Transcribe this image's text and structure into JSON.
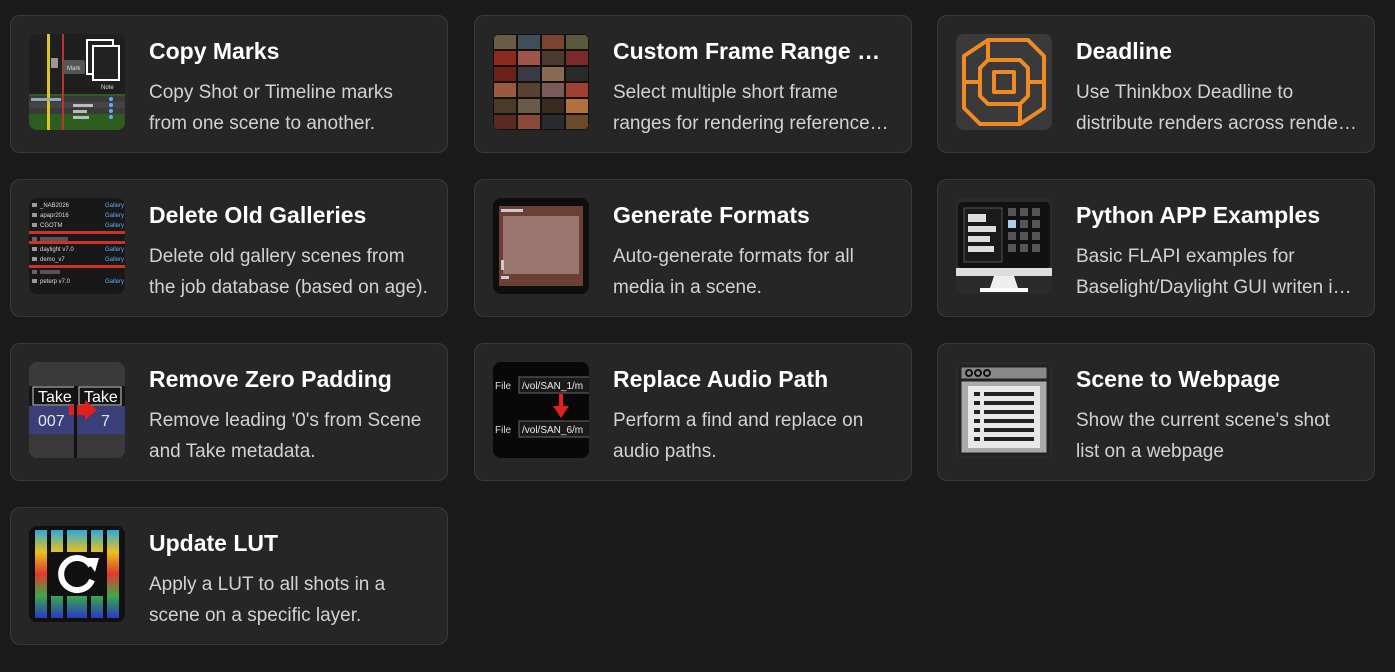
{
  "cards": [
    {
      "title": "Copy Marks",
      "desc": "Copy Shot or Timeline marks from one scene to another.",
      "icon": "copy-marks-icon"
    },
    {
      "title": "Custom Frame Range Selection",
      "desc": "Select multiple short frame ranges for rendering reference clips.",
      "icon": "frame-grid-icon"
    },
    {
      "title": "Deadline",
      "desc": "Use Thinkbox Deadline to distribute renders across render nodes.",
      "icon": "deadline-logo-icon"
    },
    {
      "title": "Delete Old Galleries",
      "desc": "Delete old gallery scenes from the job database (based on age).",
      "icon": "gallery-list-icon",
      "thumb_text": {
        "r1": "_NAB2026",
        "r2": "apapr2016",
        "r3": "CGOTM",
        "r4": "daylight v7.0",
        "r5": "demo_v7",
        "r6": "peterp v7.0",
        "tag": "Gallery"
      }
    },
    {
      "title": "Generate Formats",
      "desc": "Auto-generate formats for all media in a scene.",
      "icon": "format-frame-icon"
    },
    {
      "title": "Python APP Examples",
      "desc": "Basic FLAPI examples for Baselight/Daylight GUI writen in Python.",
      "icon": "monitor-app-icon"
    },
    {
      "title": "Remove Zero Padding",
      "desc": "Remove leading '0's from Scene and Take metadata.",
      "icon": "take-padding-icon",
      "thumb_text": {
        "h1": "Take",
        "h2": "Take",
        "v1": "007",
        "v2": "7"
      }
    },
    {
      "title": "Replace Audio Path",
      "desc": "Perform a find and replace on audio paths.",
      "icon": "audio-path-icon",
      "thumb_text": {
        "lbl": "File",
        "p1": "/vol/SAN_1/m",
        "p2": "/vol/SAN_6/m"
      }
    },
    {
      "title": "Scene to Webpage",
      "desc": "Show the current scene's shot list on a webpage",
      "icon": "webpage-list-icon"
    },
    {
      "title": "Update LUT",
      "desc": "Apply a LUT to all shots in a scene on a specific layer.",
      "icon": "refresh-lut-icon"
    }
  ]
}
